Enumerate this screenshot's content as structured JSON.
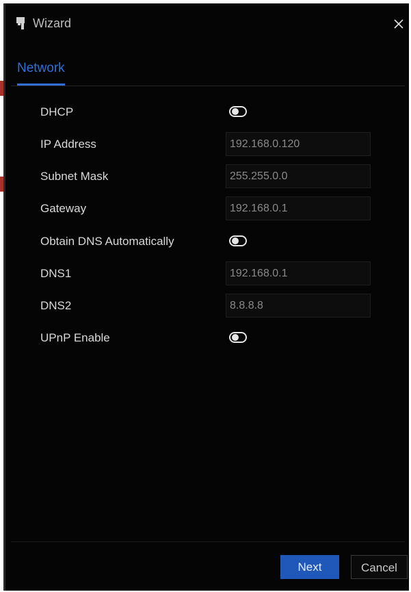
{
  "window": {
    "title": "Wizard",
    "close_symbol": "×"
  },
  "tabs": [
    {
      "label": "Network",
      "active": true
    }
  ],
  "form": {
    "dhcp": {
      "label": "DHCP",
      "enabled": false
    },
    "ip_address": {
      "label": "IP Address",
      "value": "192.168.0.120"
    },
    "subnet_mask": {
      "label": "Subnet Mask",
      "value": "255.255.0.0"
    },
    "gateway": {
      "label": "Gateway",
      "value": "192.168.0.1"
    },
    "obtain_dns": {
      "label": "Obtain DNS Automatically",
      "enabled": false
    },
    "dns1": {
      "label": "DNS1",
      "value": "192.168.0.1"
    },
    "dns2": {
      "label": "DNS2",
      "value": "8.8.8.8"
    },
    "upnp": {
      "label": "UPnP Enable",
      "enabled": false
    }
  },
  "footer": {
    "next_label": "Next",
    "cancel_label": "Cancel"
  },
  "colors": {
    "accent": "#2f6fd6",
    "button_primary": "#1f58b9",
    "background": "#050505"
  },
  "icons": {
    "title": "wizard-flag-icon",
    "close": "close-icon"
  }
}
